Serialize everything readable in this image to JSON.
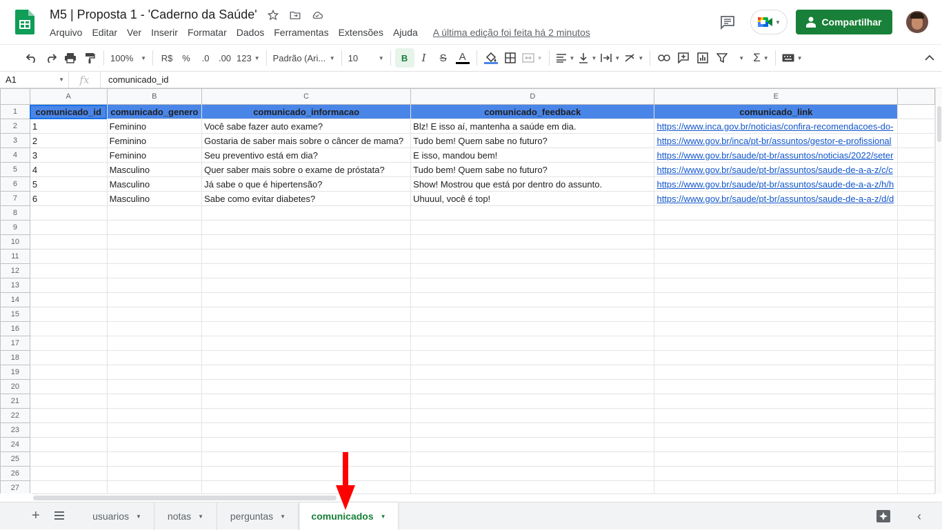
{
  "app": {
    "title": "M5 | Proposta 1 - 'Caderno da Saúde'",
    "menu": [
      "Arquivo",
      "Editar",
      "Ver",
      "Inserir",
      "Formatar",
      "Dados",
      "Ferramentas",
      "Extensões",
      "Ajuda"
    ],
    "last_edit": "A última edição foi feita há 2 minutos",
    "share_label": "Compartilhar",
    "title_icons": [
      "star-icon",
      "move-folder-icon",
      "cloud-status-icon"
    ]
  },
  "toolbar": {
    "zoom": "100%",
    "currency": "R$",
    "percent": "%",
    "dec_decrease": ".0",
    "dec_increase": ".00",
    "format_more": "123",
    "font": "Padrão (Ari...",
    "font_size": "10",
    "bold": "B",
    "italic": "I",
    "strike": "S",
    "text_color": "A"
  },
  "formula_bar": {
    "cell_ref": "A1",
    "fx": "fx",
    "content": "comunicado_id"
  },
  "columns": [
    "A",
    "B",
    "C",
    "D",
    "E"
  ],
  "header": [
    "comunicado_id",
    "comunicado_genero",
    "comunicado_informacao",
    "comunicado_feedback",
    "comunicado_link"
  ],
  "rows": [
    [
      "1",
      "Feminino",
      "Você sabe fazer auto exame?",
      "Blz! E isso aí, mantenha a saúde em dia.",
      "https://www.inca.gov.br/noticias/confira-recomendacoes-do-"
    ],
    [
      "2",
      "Feminino",
      "Gostaria de saber mais sobre o câncer de mama?",
      "Tudo bem! Quem sabe no futuro?",
      "https://www.gov.br/inca/pt-br/assuntos/gestor-e-profissional"
    ],
    [
      "3",
      "Feminino",
      "Seu preventivo está em dia?",
      "E isso, mandou bem!",
      "https://www.gov.br/saude/pt-br/assuntos/noticias/2022/seter"
    ],
    [
      "4",
      "Masculino",
      "Quer saber mais sobre o exame de próstata?",
      "Tudo bem! Quem sabe no futuro?",
      "https://www.gov.br/saude/pt-br/assuntos/saude-de-a-a-z/c/c"
    ],
    [
      "5",
      "Masculino",
      "Já sabe o que é hipertensão?",
      "Show! Mostrou que está por dentro do assunto.",
      "https://www.gov.br/saude/pt-br/assuntos/saude-de-a-a-z/h/h"
    ],
    [
      "6",
      "Masculino",
      "Sabe como evitar diabetes?",
      "Uhuuul, você é top!",
      "https://www.gov.br/saude/pt-br/assuntos/saude-de-a-a-z/d/d"
    ]
  ],
  "row_numbers": [
    "1",
    "2",
    "3",
    "4",
    "5",
    "6",
    "7",
    "8",
    "9",
    "10",
    "11",
    "12",
    "13",
    "14",
    "15",
    "16",
    "17",
    "18",
    "19",
    "20",
    "21",
    "22",
    "23",
    "24",
    "25",
    "26",
    "27"
  ],
  "sheets": [
    "usuarios",
    "notas",
    "perguntas",
    "comunicados"
  ],
  "active_sheet": "comunicados",
  "colors": {
    "header_fill": "#4a86e8",
    "share_green": "#188038",
    "link": "#1155cc",
    "arrow": "#ff0000"
  }
}
